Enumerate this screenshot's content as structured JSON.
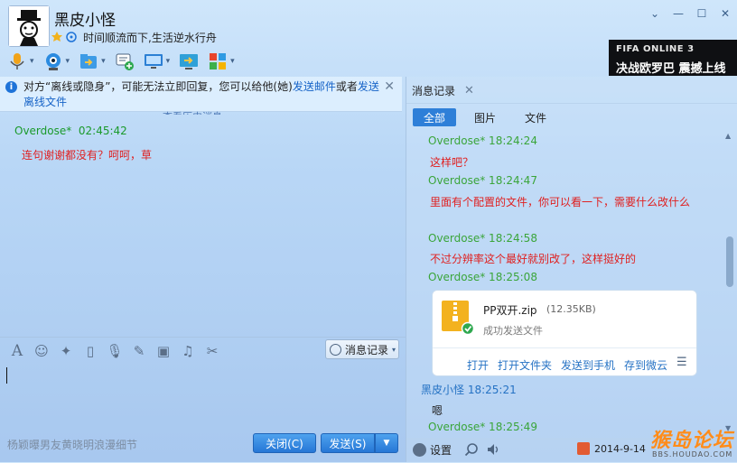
{
  "header": {
    "nickname": "黑皮小怪",
    "signature": "时间顺流而下,生活逆水行舟",
    "window_controls": [
      "chevron-down-icon",
      "minimize-icon",
      "maximize-icon",
      "close-icon"
    ],
    "banner": {
      "line1": "FIFA ONLINE 3",
      "line2": "决战欧罗巴 震撼上线"
    }
  },
  "toolbar": {
    "items": [
      "microphone-icon",
      "video-icon",
      "file-transfer-icon",
      "add-chat-icon",
      "remote-desktop-icon",
      "screen-share-icon",
      "app-grid-icon"
    ]
  },
  "notice": {
    "text_before": "对方“离线或隐身”，可能无法立即回复，您可以给他(她)",
    "link1": "发送邮件",
    "text_mid": "或者",
    "link2": "发送离线文件",
    "more_history": "查看历史消息"
  },
  "chat": {
    "messages": [
      {
        "name": "Overdose*",
        "time": "02:45:42",
        "text": "连句谢谢都没有？呵呵，草"
      }
    ]
  },
  "input_toolbar": {
    "icons": [
      "font-icon",
      "emoji-icon",
      "magic-icon",
      "shake-icon",
      "voice-icon",
      "edit-icon",
      "image-icon",
      "music-icon",
      "screenshot-icon"
    ],
    "history_label": "消息记录"
  },
  "footer": {
    "ad_text": "杨颖曝男友黄晓明浪漫细节",
    "close_label": "关闭(C)",
    "send_label": "发送(S)"
  },
  "history": {
    "tab_title": "消息记录",
    "filters": [
      "全部",
      "图片",
      "文件"
    ],
    "entries": [
      {
        "kind": "name",
        "text": "Overdose*  18:24:24"
      },
      {
        "kind": "msg",
        "text": "这样吧？"
      },
      {
        "kind": "name",
        "text": "Overdose*  18:24:47"
      },
      {
        "kind": "msg",
        "text": "里面有个配置的文件，你可以看一下，需要什么改什么"
      },
      {
        "kind": "name",
        "text": "Overdose*  18:24:58"
      },
      {
        "kind": "msg",
        "text": "不过分辨率这个最好就别改了，这样挺好的"
      },
      {
        "kind": "name",
        "text": "Overdose*  18:25:08"
      }
    ],
    "file": {
      "name": "PP双开.zip",
      "size": "(12.35KB)",
      "status": "成功发送文件",
      "actions": [
        "打开",
        "打开文件夹",
        "发送到手机",
        "存到微云"
      ]
    },
    "after": [
      {
        "kind": "self",
        "text": "黑皮小怪  18:25:21"
      },
      {
        "kind": "plain",
        "text": "嗯"
      },
      {
        "kind": "name",
        "text": "Overdose*  18:25:49"
      }
    ],
    "settings_label": "设置",
    "date": "2014-9-14"
  },
  "watermark": {
    "main": "猴岛论坛",
    "sub": "BBS.HOUDAO.COM"
  },
  "colors": {
    "accent": "#2e7fd8",
    "peer_name": "#3aa53a",
    "self_name": "#2572c4",
    "message_red": "#e02020",
    "bg": "#b9d7f6"
  }
}
